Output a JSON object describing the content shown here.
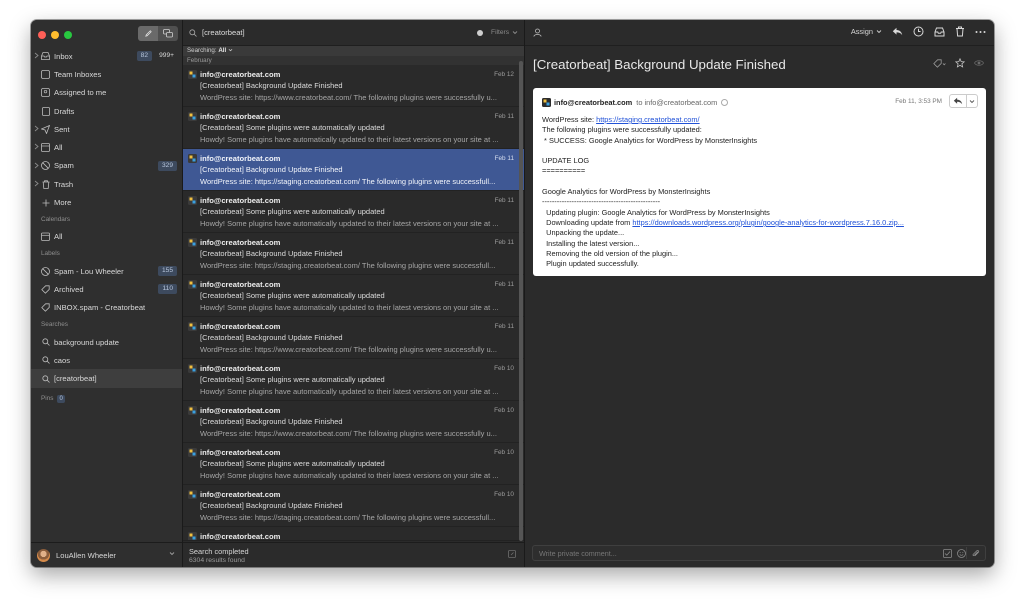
{
  "sidebar": {
    "items": [
      {
        "label": "Inbox",
        "count": "82",
        "extra": "999+"
      },
      {
        "label": "Team Inboxes"
      },
      {
        "label": "Assigned to me"
      },
      {
        "label": "Drafts"
      },
      {
        "label": "Sent"
      },
      {
        "label": "All"
      },
      {
        "label": "Spam",
        "count": "329"
      },
      {
        "label": "Trash"
      },
      {
        "label": "More"
      }
    ],
    "calendars_heading": "Calendars",
    "calendars": [
      {
        "label": "All"
      }
    ],
    "labels_heading": "Labels",
    "labels": [
      {
        "label": "Spam - Lou Wheeler",
        "count": "155"
      },
      {
        "label": "Archived",
        "count": "110"
      },
      {
        "label": "INBOX.spam - Creatorbeat"
      }
    ],
    "searches_heading": "Searches",
    "searches": [
      {
        "label": "background update"
      },
      {
        "label": "caos"
      },
      {
        "label": "[creatorbeat]"
      }
    ],
    "pins_heading": "Pins",
    "pins_count": "0",
    "user_name": "LouAllen Wheeler"
  },
  "list": {
    "query": "[creatorbeat]",
    "filters_label": "Filters",
    "searching_prefix": "Searching:",
    "searching_scope": "All",
    "month": "February",
    "messages": [
      {
        "from": "info@creatorbeat.com",
        "date": "Feb 12",
        "subject": "[Creatorbeat] Background Update Finished",
        "preview": "WordPress site: https://www.creatorbeat.com/ The following plugins were successfully u..."
      },
      {
        "from": "info@creatorbeat.com",
        "date": "Feb 11",
        "subject": "[Creatorbeat] Some plugins were automatically updated",
        "preview": "Howdy! Some plugins have automatically updated to their latest versions on your site at ..."
      },
      {
        "from": "info@creatorbeat.com",
        "date": "Feb 11",
        "subject": "[Creatorbeat] Background Update Finished",
        "preview": "WordPress site: https://staging.creatorbeat.com/ The following plugins were successfull..."
      },
      {
        "from": "info@creatorbeat.com",
        "date": "Feb 11",
        "subject": "[Creatorbeat] Some plugins were automatically updated",
        "preview": "Howdy! Some plugins have automatically updated to their latest versions on your site at ..."
      },
      {
        "from": "info@creatorbeat.com",
        "date": "Feb 11",
        "subject": "[Creatorbeat] Background Update Finished",
        "preview": "WordPress site: https://staging.creatorbeat.com/ The following plugins were successfull..."
      },
      {
        "from": "info@creatorbeat.com",
        "date": "Feb 11",
        "subject": "[Creatorbeat] Some plugins were automatically updated",
        "preview": "Howdy! Some plugins have automatically updated to their latest versions on your site at ..."
      },
      {
        "from": "info@creatorbeat.com",
        "date": "Feb 11",
        "subject": "[Creatorbeat] Background Update Finished",
        "preview": "WordPress site: https://www.creatorbeat.com/ The following plugins were successfully u..."
      },
      {
        "from": "info@creatorbeat.com",
        "date": "Feb 10",
        "subject": "[Creatorbeat] Some plugins were automatically updated",
        "preview": "Howdy! Some plugins have automatically updated to their latest versions on your site at ..."
      },
      {
        "from": "info@creatorbeat.com",
        "date": "Feb 10",
        "subject": "[Creatorbeat] Background Update Finished",
        "preview": "WordPress site: https://www.creatorbeat.com/ The following plugins were successfully u..."
      },
      {
        "from": "info@creatorbeat.com",
        "date": "Feb 10",
        "subject": "[Creatorbeat] Some plugins were automatically updated",
        "preview": "Howdy! Some plugins have automatically updated to their latest versions on your site at ..."
      },
      {
        "from": "info@creatorbeat.com",
        "date": "Feb 10",
        "subject": "[Creatorbeat] Background Update Finished",
        "preview": "WordPress site: https://staging.creatorbeat.com/ The following plugins were successfull..."
      },
      {
        "from": "info@creatorbeat.com",
        "date": "",
        "subject": "",
        "preview": ""
      }
    ],
    "selected_index": 2,
    "status": "Search completed",
    "results": "6304 results found"
  },
  "reader": {
    "assign_label": "Assign",
    "title": "[Creatorbeat] Background Update Finished",
    "from": "info@creatorbeat.com",
    "to": "to info@creatorbeat.com",
    "date": "Feb 11, 3:53 PM",
    "body": {
      "l1_prefix": "WordPress site: ",
      "l1_link": "https://staging.creatorbeat.com/",
      "l2": "The following plugins were successfully updated:",
      "l3": " * SUCCESS: Google Analytics for WordPress by MonsterInsights",
      "l5": "UPDATE LOG",
      "l6": "==========",
      "l8": "Google Analytics for WordPress by MonsterInsights",
      "l9": "------------------------------------------------",
      "l10": "  Updating plugin: Google Analytics for WordPress by MonsterInsights",
      "l11_prefix": "  Downloading update from ",
      "l11_link": "https://downloads.wordpress.org/plugin/google-analytics-for-wordpress.7.16.0.zip...",
      "l12": "  Unpacking the update...",
      "l13": "  Installing the latest version...",
      "l14": "  Removing the old version of the plugin...",
      "l15": "  Plugin updated successfully."
    },
    "comment_placeholder": "Write private comment..."
  },
  "colors": {
    "selected_row": "#3f5894",
    "badge_bg": "#3d4a5e",
    "link": "#2152d8"
  }
}
